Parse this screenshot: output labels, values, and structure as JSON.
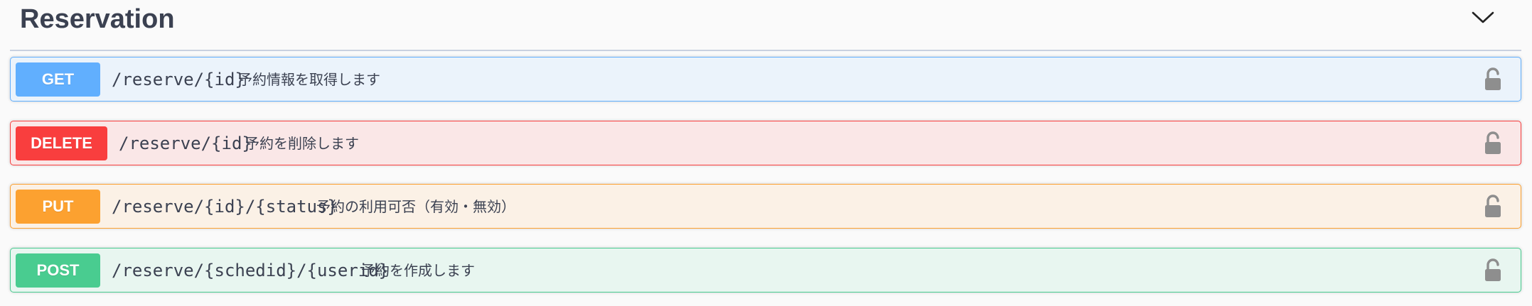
{
  "section": {
    "title": "Reservation",
    "chevron_icon": "chevron-down-icon"
  },
  "colors": {
    "get": "#61affe",
    "delete": "#f93e3e",
    "put": "#fca130",
    "post": "#49cc90",
    "text": "#3b4151",
    "lock": "#8e8e8e"
  },
  "operations": [
    {
      "method": "GET",
      "path": "/reserve/{id}",
      "summary": "予約情報を取得します",
      "lock_icon": "unlocked-padlock-icon"
    },
    {
      "method": "DELETE",
      "path": "/reserve/{id}",
      "summary": "予約を削除します",
      "lock_icon": "unlocked-padlock-icon"
    },
    {
      "method": "PUT",
      "path": "/reserve/{id}/{status}",
      "summary": "予約の利用可否（有効・無効）",
      "lock_icon": "unlocked-padlock-icon"
    },
    {
      "method": "POST",
      "path": "/reserve/{schedid}/{userid}",
      "summary": "予約を作成します",
      "lock_icon": "unlocked-padlock-icon"
    }
  ]
}
